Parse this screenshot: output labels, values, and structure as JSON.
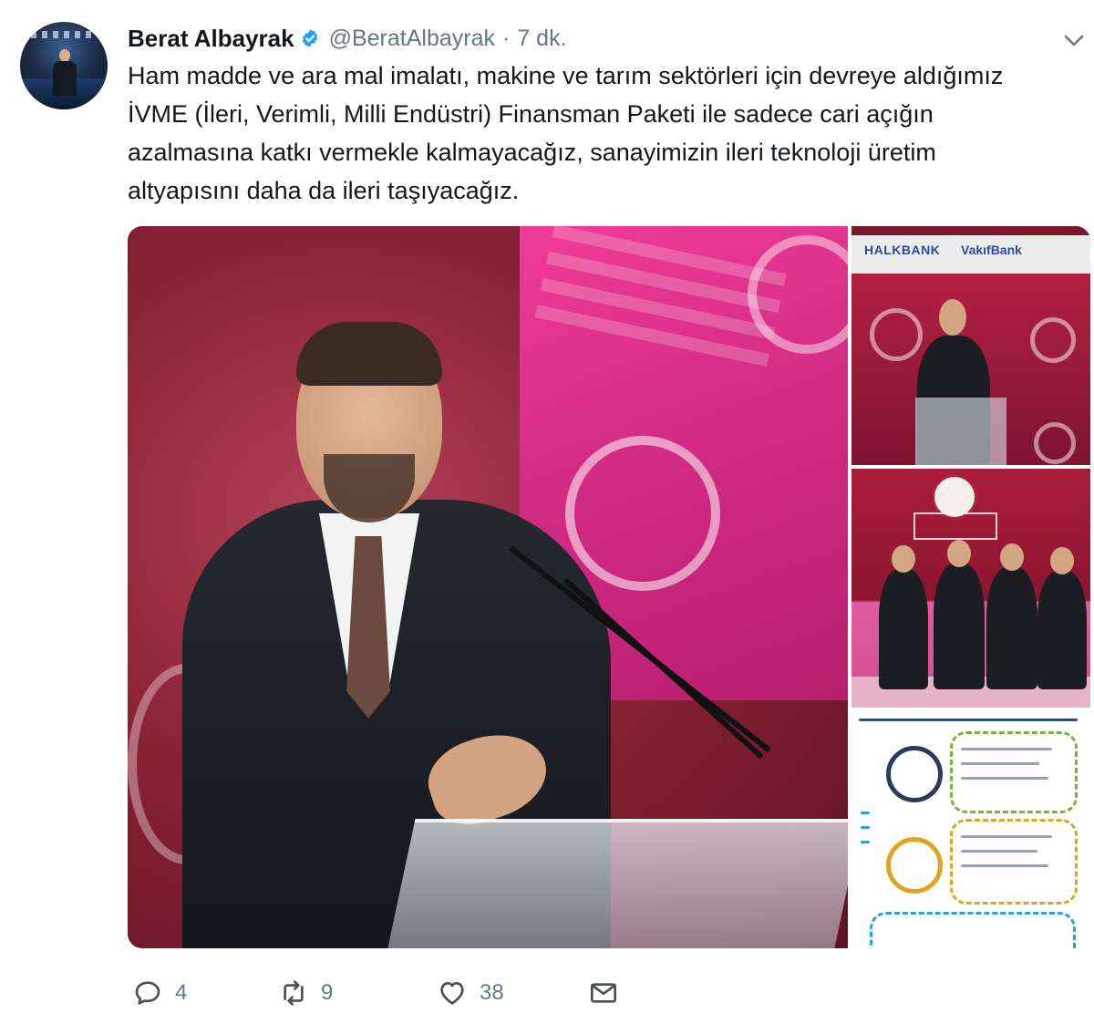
{
  "tweet": {
    "author_name": "Berat Albayrak",
    "handle": "@BeratAlbayrak",
    "separator": "·",
    "time": "7 dk.",
    "text_lines": [
      "Ham madde ve ara mal imalatı, makine ve tarım sektörleri için devreye aldığımız",
      "İVME (İleri, Verimli, Milli Endüstri) Finansman Paketi ile sadece cari açığın",
      "azalmasına katkı vermekle kalmayacağız, sanayimizin ileri teknoloji üretim",
      "altyapısını daha da ileri taşıyacağız."
    ]
  },
  "media": {
    "thumb1_banks": [
      "HALKBANK",
      "VakıfBank"
    ]
  },
  "actions": {
    "reply_count": "4",
    "retweet_count": "9",
    "like_count": "38"
  },
  "icons": {
    "verified": "verified-badge-icon",
    "more": "chevron-down-icon",
    "reply": "reply-icon",
    "retweet": "retweet-icon",
    "like": "heart-icon",
    "dm": "envelope-icon"
  },
  "colors": {
    "accent": "#1da1f2",
    "text": "#14171a",
    "muted": "#657786"
  }
}
